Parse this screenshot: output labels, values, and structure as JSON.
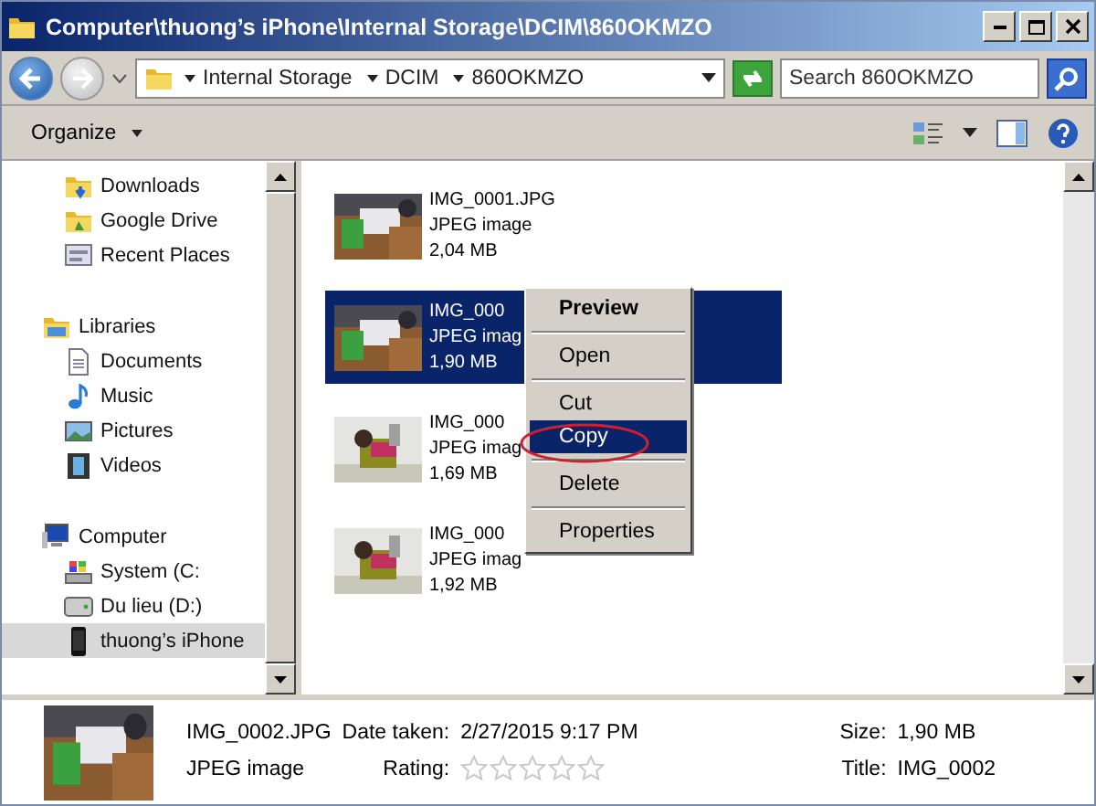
{
  "window": {
    "title": "Computer\\thuong’s iPhone\\Internal Storage\\DCIM\\860OKMZO"
  },
  "address_bar": {
    "crumbs": [
      "Internal Storage",
      "DCIM",
      "860OKMZO"
    ]
  },
  "search": {
    "placeholder": "Search 860OKMZO"
  },
  "toolbar": {
    "organize": "Organize"
  },
  "sidebar": {
    "sections": [
      {
        "items": [
          {
            "label": "Downloads",
            "kind": "downloads",
            "selected": false
          },
          {
            "label": "Google Drive",
            "kind": "drive-folder",
            "selected": false
          },
          {
            "label": "Recent Places",
            "kind": "recent",
            "selected": false
          }
        ]
      },
      {
        "label": "Libraries",
        "kind": "library",
        "items": [
          {
            "label": "Documents",
            "kind": "document",
            "selected": false
          },
          {
            "label": "Music",
            "kind": "music",
            "selected": false
          },
          {
            "label": "Pictures",
            "kind": "pictures",
            "selected": false
          },
          {
            "label": "Videos",
            "kind": "videos",
            "selected": false
          }
        ]
      },
      {
        "label": "Computer",
        "kind": "computer",
        "items": [
          {
            "label": "System (C:",
            "kind": "system-drive",
            "selected": false
          },
          {
            "label": "Du lieu (D:)",
            "kind": "disk",
            "selected": false
          },
          {
            "label": "thuong’s iPhone",
            "kind": "phone",
            "selected": true
          }
        ]
      }
    ]
  },
  "files": [
    {
      "name": "IMG_0001.JPG",
      "type": "JPEG image",
      "size": "2,04 MB",
      "selected": false
    },
    {
      "name": "IMG_000",
      "type": "JPEG imag",
      "size": "1,90 MB",
      "selected": true
    },
    {
      "name": "IMG_000",
      "type": "JPEG imag",
      "size": "1,69 MB",
      "selected": false
    },
    {
      "name": "IMG_000",
      "type": "JPEG imag",
      "size": "1,92 MB",
      "selected": false
    }
  ],
  "context_menu": {
    "groups": [
      [
        {
          "label": "Preview",
          "default": true,
          "selected": false
        }
      ],
      [
        {
          "label": "Open",
          "default": false,
          "selected": false
        }
      ],
      [
        {
          "label": "Cut",
          "default": false,
          "selected": false
        },
        {
          "label": "Copy",
          "default": false,
          "selected": true,
          "circled": true
        }
      ],
      [
        {
          "label": "Delete",
          "default": false,
          "selected": false
        }
      ],
      [
        {
          "label": "Properties",
          "default": false,
          "selected": false
        }
      ]
    ]
  },
  "details": {
    "name": "IMG_0002.JPG",
    "type": "JPEG image",
    "date_label": "Date taken:",
    "date": "2/27/2015 9:17 PM",
    "rating_label": "Rating:",
    "stars": 0,
    "size_label": "Size:",
    "size": "1,90 MB",
    "title_label": "Title:",
    "title": "IMG_0002"
  }
}
